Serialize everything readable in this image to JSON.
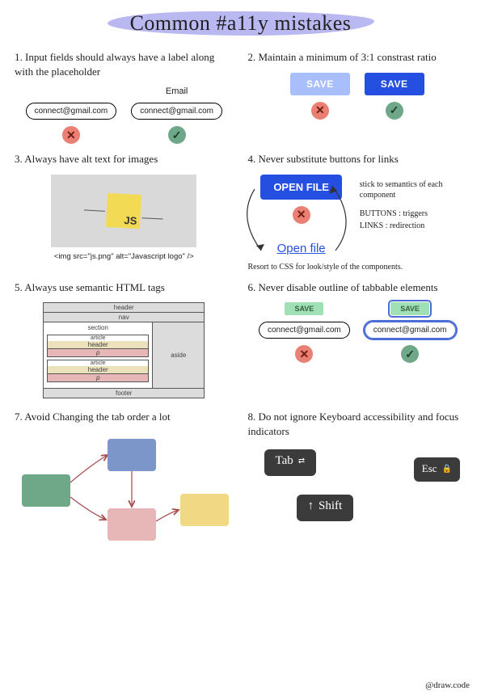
{
  "title": "Common #a11y mistakes",
  "credit": "@draw.code",
  "tips": {
    "t1": {
      "heading": "1.  Input fields should always have a label along with the placeholder",
      "label": "Email",
      "value": "connect@gmail.com"
    },
    "t2": {
      "heading": "2. Maintain a minimum of 3:1 constrast ratio",
      "btn": "SAVE"
    },
    "t3": {
      "heading": "3. Always have alt text for images",
      "logo": "JS",
      "code": "<img src=\"js.png\" alt=\"Javascript logo\" />"
    },
    "t4": {
      "heading": "4. Never substitute buttons for links",
      "btn": "OPEN FILE",
      "link": "Open file",
      "note1": "stick to semantics of each component",
      "note2a": "BUTTONS : triggers",
      "note2b": "LINKS : redirection",
      "footer": "Resort to CSS for look/style of the components."
    },
    "t5": {
      "heading": "5. Always use semantic HTML tags",
      "labels": {
        "header": "header",
        "nav": "nav",
        "section": "section",
        "article": "article",
        "aheader": "header",
        "p": "p",
        "aside": "aside",
        "footer": "footer"
      }
    },
    "t6": {
      "heading": "6. Never disable outline of tabbable elements",
      "chip": "SAVE",
      "value": "connect@gmail.com"
    },
    "t7": {
      "heading": "7. Avoid Changing the tab order a lot"
    },
    "t8": {
      "heading": "8. Do not ignore Keyboard accessibility and focus indicators",
      "tab": "Tab",
      "esc": "Esc",
      "shift": "Shift"
    }
  }
}
